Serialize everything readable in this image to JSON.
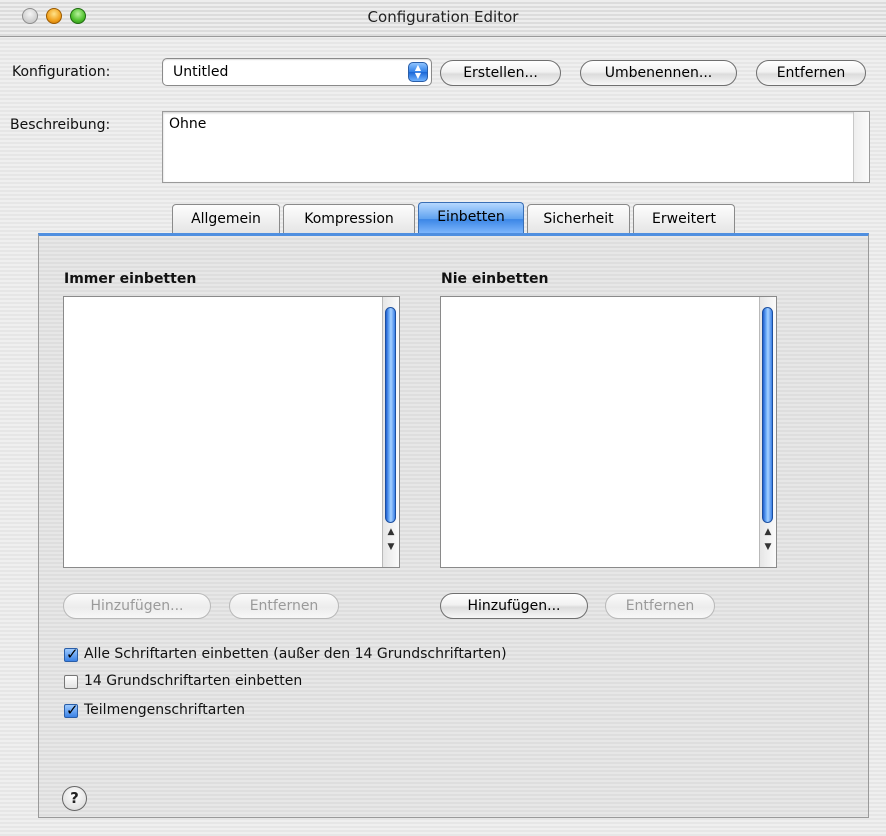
{
  "window": {
    "title": "Configuration Editor"
  },
  "config": {
    "label": "Konfiguration:",
    "selected": "Untitled",
    "create_label": "Erstellen...",
    "rename_label": "Umbenennen...",
    "remove_label": "Entfernen"
  },
  "description": {
    "label": "Beschreibung:",
    "value": "Ohne"
  },
  "tabs": [
    {
      "label": "Allgemein"
    },
    {
      "label": "Kompression"
    },
    {
      "label": "Einbetten",
      "active": true
    },
    {
      "label": "Sicherheit"
    },
    {
      "label": "Erweitert"
    }
  ],
  "embed": {
    "always_heading": "Immer einbetten",
    "never_heading": "Nie einbetten",
    "always_add": "Hinzufügen...",
    "always_remove": "Entfernen",
    "never_add": "Hinzufügen...",
    "never_remove": "Entfernen"
  },
  "checkboxes": [
    {
      "label": "Alle Schriftarten einbetten (außer den 14 Grundschriftarten)",
      "checked": true
    },
    {
      "label": "14 Grundschriftarten einbetten",
      "checked": false
    },
    {
      "label": "Teilmengenschriftarten",
      "checked": true
    }
  ],
  "help": {
    "glyph": "?"
  },
  "colors": {
    "accent": "#3b86e6"
  }
}
